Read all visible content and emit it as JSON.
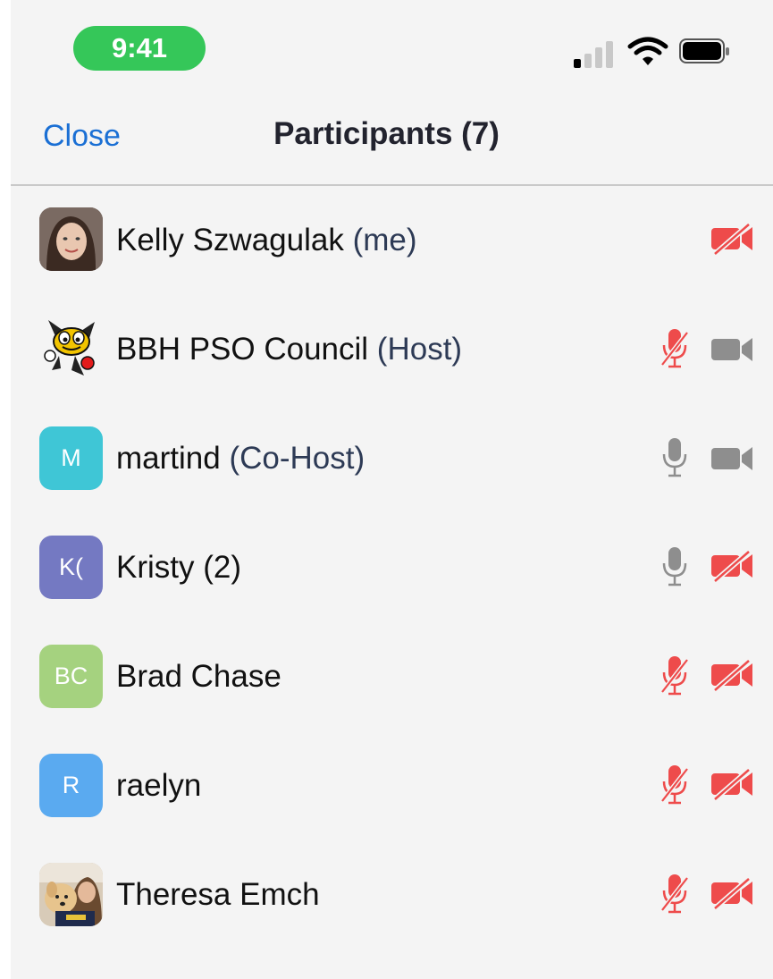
{
  "status_bar": {
    "time": "9:41",
    "signal_icon": "cellular-signal-icon",
    "wifi_icon": "wifi-icon",
    "battery_icon": "battery-icon",
    "colors": {
      "time_pill": "#35c759"
    }
  },
  "nav": {
    "close_label": "Close",
    "title": "Participants (7)",
    "accent_color": "#1a6fd4"
  },
  "participants": [
    {
      "name": "Kelly Szwagulak",
      "role": "(me)",
      "avatar_type": "photo",
      "avatar_desc": "profile-photo",
      "mic": "none",
      "video": "off"
    },
    {
      "name": "BBH PSO Council",
      "role": "(Host)",
      "avatar_type": "logo",
      "avatar_desc": "hornet-mascot-logo",
      "mic": "muted",
      "video": "on"
    },
    {
      "name": "martind",
      "role": "(Co-Host)",
      "avatar_type": "initials",
      "initials": "M",
      "avatar_color": "#3fc6d6",
      "mic": "on",
      "video": "on"
    },
    {
      "name": "Kristy (2)",
      "role": "",
      "avatar_type": "initials",
      "initials": "K(",
      "avatar_color": "#7479c2",
      "mic": "on",
      "video": "off"
    },
    {
      "name": "Brad Chase",
      "role": "",
      "avatar_type": "initials",
      "initials": "BC",
      "avatar_color": "#a5d27f",
      "mic": "muted",
      "video": "off"
    },
    {
      "name": "raelyn",
      "role": "",
      "avatar_type": "initials",
      "initials": "R",
      "avatar_color": "#5aaaf0",
      "mic": "muted",
      "video": "off"
    },
    {
      "name": "Theresa Emch",
      "role": "",
      "avatar_type": "photo",
      "avatar_desc": "profile-photo-with-dog",
      "mic": "muted",
      "video": "off"
    }
  ],
  "icon_colors": {
    "muted": "#ee4b4b",
    "active": "#8e8e8e"
  }
}
